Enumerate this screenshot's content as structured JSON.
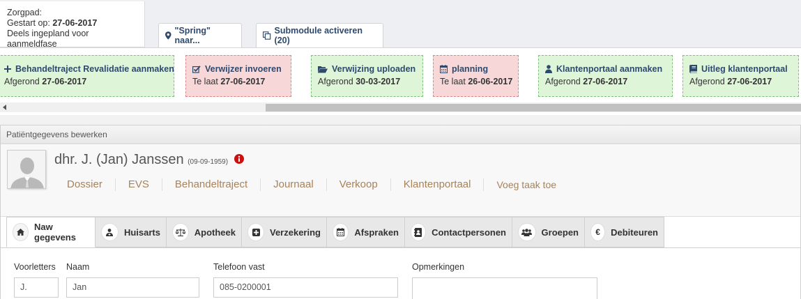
{
  "zorgpad": {
    "title": "Zorgpad:",
    "started_label": "Gestart op:",
    "started_date": "27-06-2017",
    "status": "Deels ingepland voor aanmeldfase"
  },
  "top_buttons": {
    "spring": "\"Spring\" naar...",
    "submodule": "Submodule activeren (20)"
  },
  "tasks": [
    {
      "title": "Behandeltraject Revalidatie aanmaken",
      "status_label": "Afgerond",
      "date": "27-06-2017",
      "state": "green",
      "icon": "plus-icon"
    },
    {
      "title": "Verwijzer invoeren",
      "status_label": "Te laat",
      "date": "27-06-2017",
      "state": "red",
      "icon": "check-square-icon"
    },
    {
      "title": "Verwijzing uploaden",
      "status_label": "Afgerond",
      "date": "30-03-2017",
      "state": "green",
      "icon": "folder-open-icon"
    },
    {
      "title": "planning",
      "status_label": "Te laat",
      "date": "26-06-2017",
      "state": "red",
      "icon": "calendar-icon"
    },
    {
      "title": "Klantenportaal aanmaken",
      "status_label": "Afgerond",
      "date": "27-06-2017",
      "state": "green",
      "icon": "user-icon"
    },
    {
      "title": "Uitleg klantenportaal",
      "status_label": "Afgerond",
      "date": "27-06-2017",
      "state": "green",
      "icon": "book-icon"
    }
  ],
  "panel": {
    "title": "Patiëntgegevens bewerken"
  },
  "patient": {
    "name": "dhr. J. (Jan) Janssen",
    "dob": "(09-09-1959)"
  },
  "nav_links": [
    "Dossier",
    "EVS",
    "Behandeltraject",
    "Journaal",
    "Verkoop",
    "Klantenportaal",
    "Voeg taak toe"
  ],
  "tabs": [
    {
      "label": "Naw gegevens",
      "icon": "home-icon",
      "active": true
    },
    {
      "label": "Huisarts",
      "icon": "doctor-icon"
    },
    {
      "label": "Apotheek",
      "icon": "scale-icon"
    },
    {
      "label": "Verzekering",
      "icon": "plus-square-icon"
    },
    {
      "label": "Afspraken",
      "icon": "calendar-icon"
    },
    {
      "label": "Contactpersonen",
      "icon": "address-book-icon"
    },
    {
      "label": "Groepen",
      "icon": "users-icon"
    },
    {
      "label": "Debiteuren",
      "icon": "euro-icon"
    }
  ],
  "form": {
    "voorletters": {
      "label": "Voorletters",
      "value": "J."
    },
    "naam": {
      "label": "Naam",
      "value": "Jan"
    },
    "telefoon": {
      "label": "Telefoon vast",
      "value": "085-0200001"
    },
    "opmerkingen": {
      "label": "Opmerkingen",
      "value": ""
    }
  },
  "colors": {
    "accent_text": "#2d4a6e",
    "nav_link": "#a8825a",
    "done_bg": "#dff5d8",
    "late_bg": "#f8d7d8",
    "info_red": "#cc1111"
  }
}
